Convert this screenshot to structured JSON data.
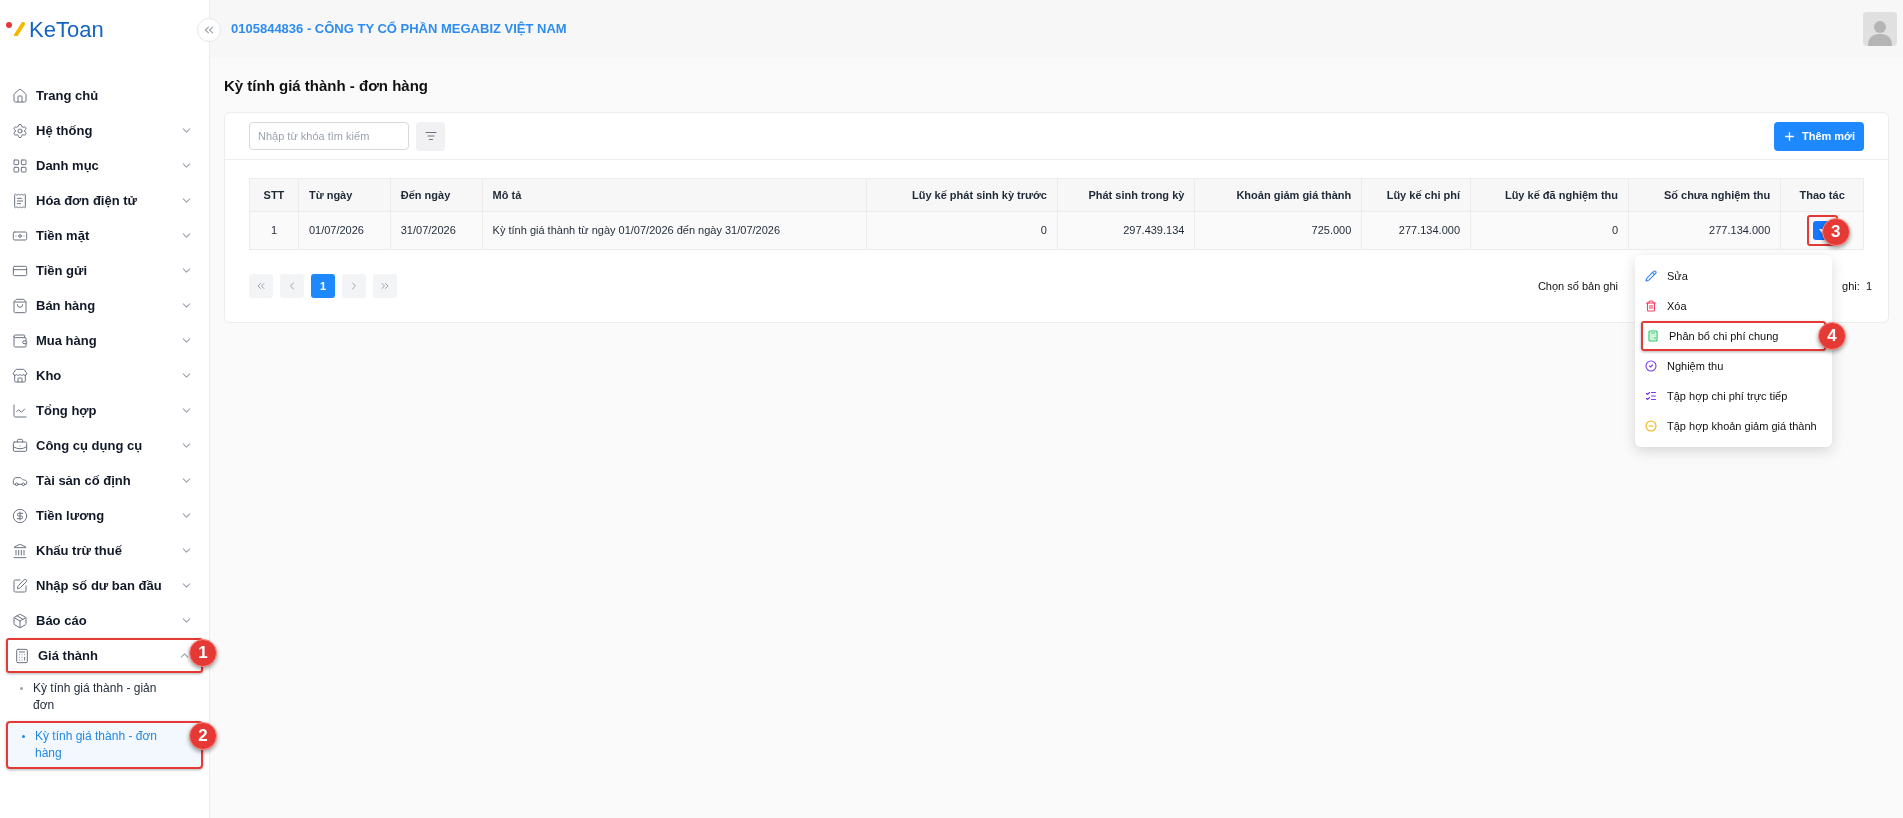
{
  "logo": {
    "text": "KeToan"
  },
  "sidebar": {
    "items": [
      {
        "label": "Trang chủ",
        "kind": "link"
      },
      {
        "label": "Hệ thống",
        "kind": "group",
        "expanded": false
      },
      {
        "label": "Danh mục",
        "kind": "group",
        "expanded": false
      },
      {
        "label": "Hóa đơn điện tử",
        "kind": "group",
        "expanded": false
      },
      {
        "label": "Tiền mặt",
        "kind": "group",
        "expanded": false
      },
      {
        "label": "Tiền gửi",
        "kind": "group",
        "expanded": false
      },
      {
        "label": "Bán hàng",
        "kind": "group",
        "expanded": false
      },
      {
        "label": "Mua hàng",
        "kind": "group",
        "expanded": false
      },
      {
        "label": "Kho",
        "kind": "group",
        "expanded": false
      },
      {
        "label": "Tổng hợp",
        "kind": "group",
        "expanded": false
      },
      {
        "label": "Công cụ dụng cụ",
        "kind": "group",
        "expanded": false
      },
      {
        "label": "Tài sản cố định",
        "kind": "group",
        "expanded": false
      },
      {
        "label": "Tiền lương",
        "kind": "group",
        "expanded": false
      },
      {
        "label": "Khấu trừ thuế",
        "kind": "group",
        "expanded": false
      },
      {
        "label": "Nhập số dư ban đầu",
        "kind": "group",
        "expanded": false
      },
      {
        "label": "Báo cáo",
        "kind": "group",
        "expanded": false
      },
      {
        "label": "Giá thành",
        "kind": "group",
        "expanded": true,
        "callout": "1",
        "children": [
          {
            "label": "Kỳ tính giá thành - giản đơn",
            "selected": false
          },
          {
            "label": "Kỳ tính giá thành - đơn hàng",
            "selected": true,
            "callout": "2"
          }
        ]
      }
    ]
  },
  "header": {
    "company": "0105844836 - CÔNG TY CỔ PHẦN MEGABIZ VIỆT NAM"
  },
  "page": {
    "title": "Kỳ tính giá thành - đơn hàng"
  },
  "toolbar": {
    "search": {
      "placeholder": "Nhập từ khóa tìm kiếm"
    },
    "add_button": "Thêm mới"
  },
  "table": {
    "columns": [
      {
        "label": "STT"
      },
      {
        "label": "Từ ngày"
      },
      {
        "label": "Đến ngày"
      },
      {
        "label": "Mô tả"
      },
      {
        "label": "Lũy kế phát sinh kỳ trước"
      },
      {
        "label": "Phát sinh trong kỳ"
      },
      {
        "label": "Khoản giảm giá thành"
      },
      {
        "label": "Lũy kế chi phí"
      },
      {
        "label": "Lũy kế đã nghiệm thu"
      },
      {
        "label": "Số chưa nghiệm thu"
      },
      {
        "label": "Thao tác"
      }
    ],
    "rows": [
      {
        "cells": [
          "1",
          "01/07/2026",
          "31/07/2026",
          "Kỳ tính giá thành từ ngày 01/07/2026 đến ngày 31/07/2026",
          "0",
          "297.439.134",
          "725.000",
          "277.134.000",
          "0",
          "277.134.000"
        ],
        "action_callout": "3"
      }
    ]
  },
  "pagination": {
    "pages": [
      {
        "label": "1",
        "selected": true
      }
    ],
    "page_size_label": "Chọn số bản ghi",
    "total_label": "ghi:  1"
  },
  "action_menu": {
    "items": [
      {
        "label": "Sửa"
      },
      {
        "label": "Xóa"
      },
      {
        "label": "Phân bổ chi phí chung",
        "callout": "4"
      },
      {
        "label": "Nghiệm thu"
      },
      {
        "label": "Tập hợp chi phí trực tiếp"
      },
      {
        "label": "Tập hợp khoản giảm giá thành"
      }
    ]
  }
}
